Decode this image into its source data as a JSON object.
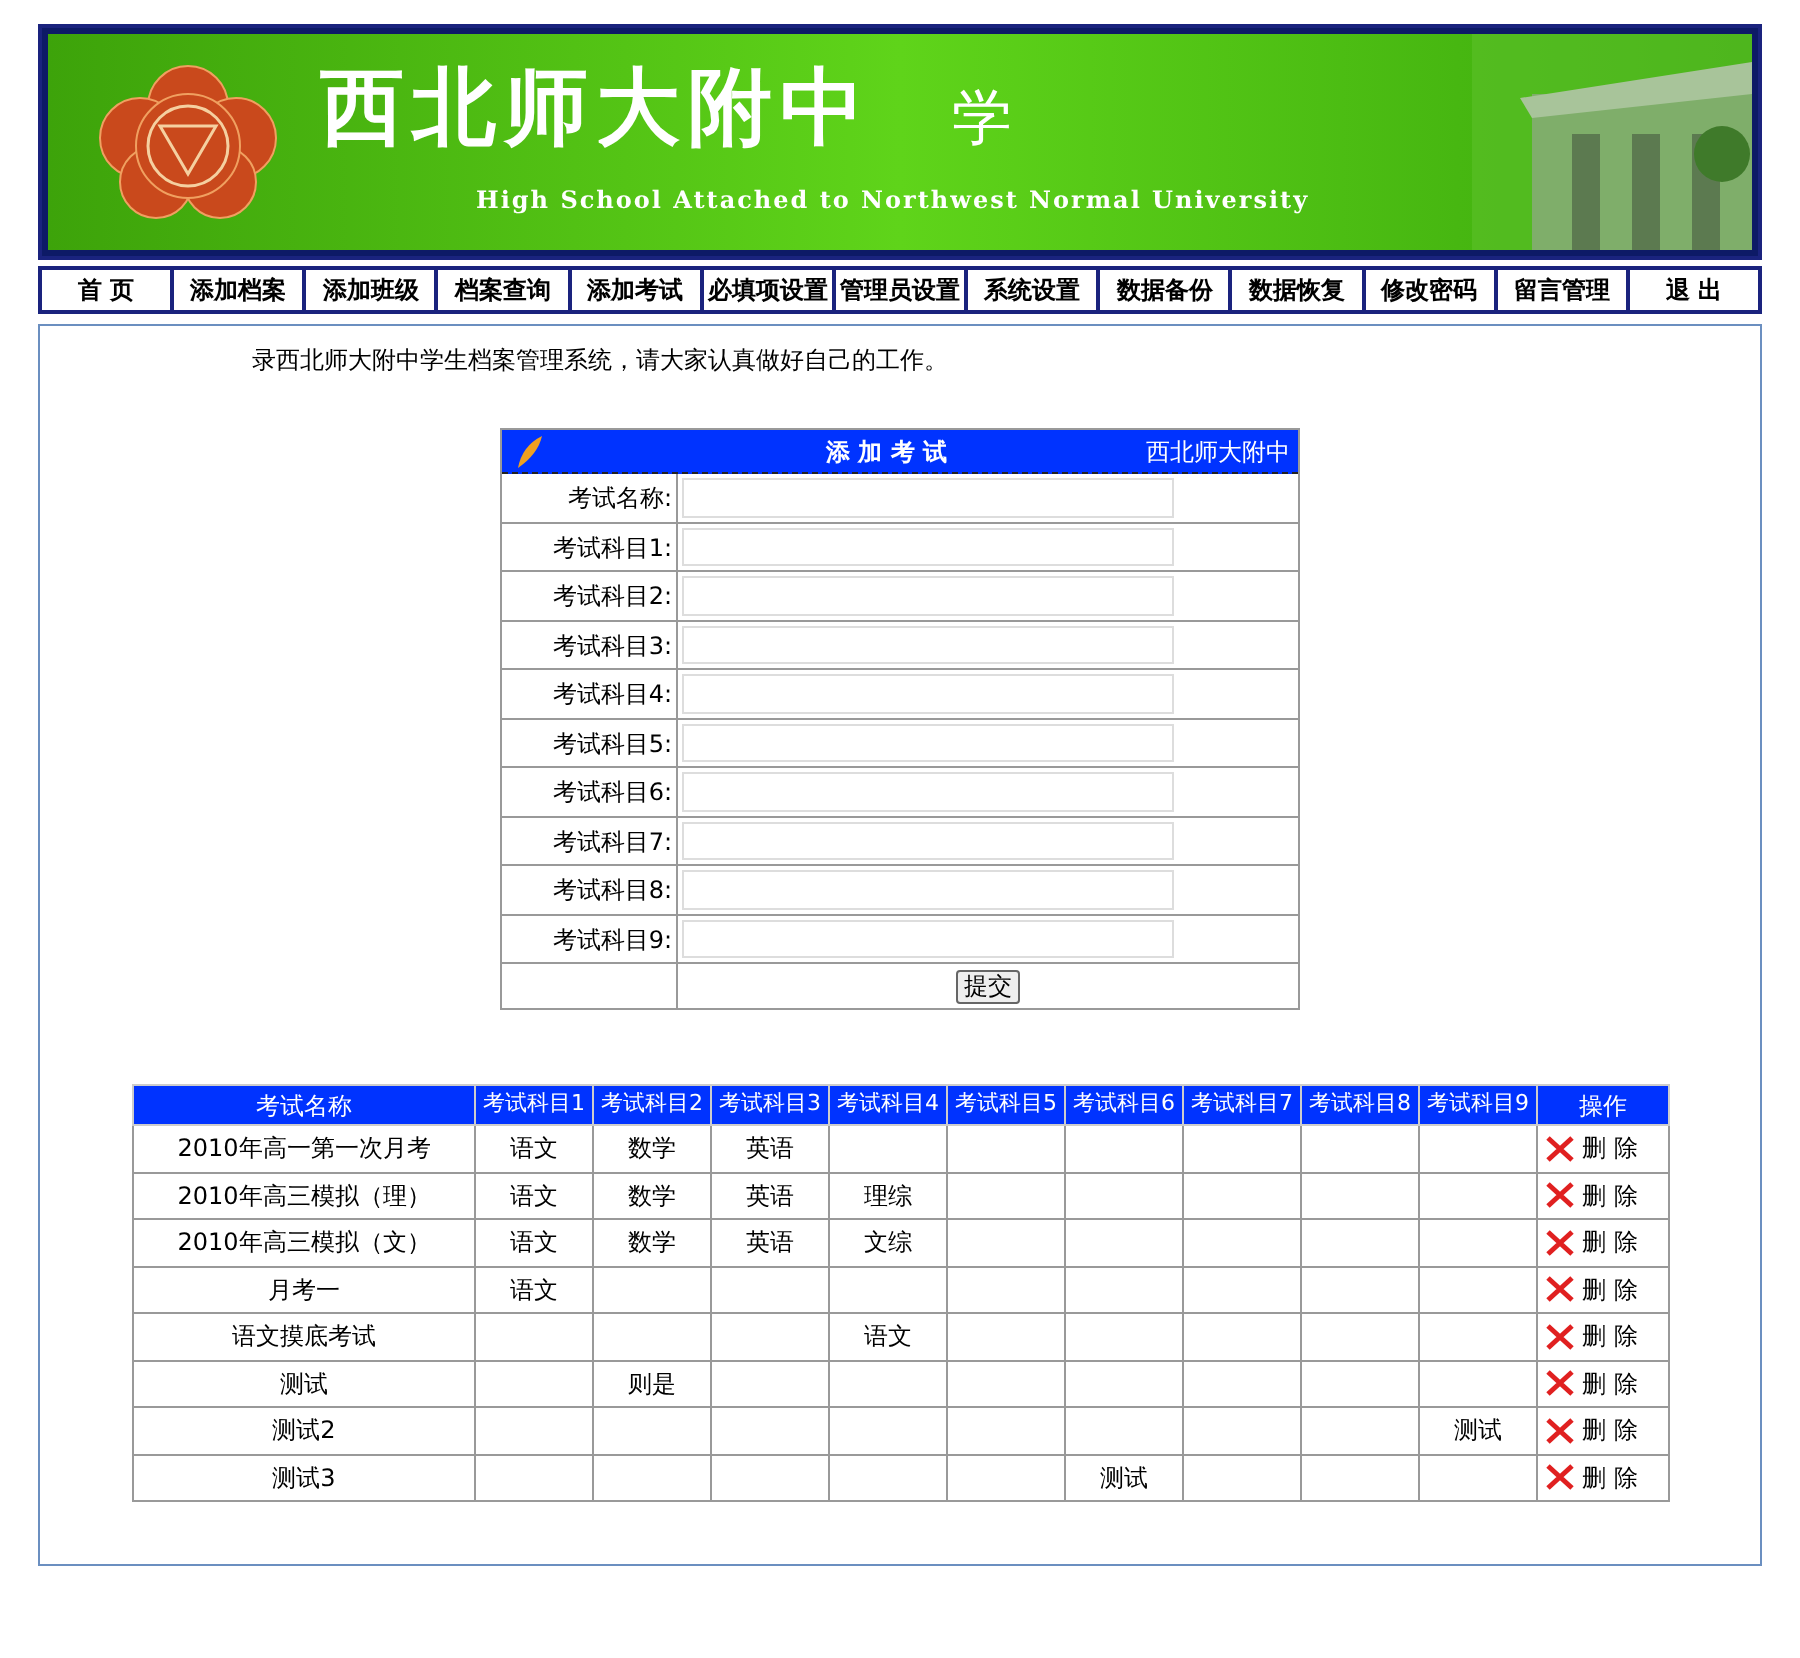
{
  "banner": {
    "title": "西北师大附中",
    "title_extra": "学",
    "subtitle": "High School Attached to Northwest Normal University"
  },
  "nav": [
    {
      "label": "首 页"
    },
    {
      "label": "添加档案"
    },
    {
      "label": "添加班级"
    },
    {
      "label": "档案查询"
    },
    {
      "label": "添加考试"
    },
    {
      "label": "必填项设置"
    },
    {
      "label": "管理员设置"
    },
    {
      "label": "系统设置"
    },
    {
      "label": "数据备份"
    },
    {
      "label": "数据恢复"
    },
    {
      "label": "修改密码"
    },
    {
      "label": "留言管理"
    },
    {
      "label": "退 出"
    }
  ],
  "welcome": "录西北师大附中学生档案管理系统，请大家认真做好自己的工作。",
  "form": {
    "title": "添 加 考 试",
    "brand": "西北师大附中",
    "fields": [
      {
        "label": "考试名称:"
      },
      {
        "label": "考试科目1:"
      },
      {
        "label": "考试科目2:"
      },
      {
        "label": "考试科目3:"
      },
      {
        "label": "考试科目4:"
      },
      {
        "label": "考试科目5:"
      },
      {
        "label": "考试科目6:"
      },
      {
        "label": "考试科目7:"
      },
      {
        "label": "考试科目8:"
      },
      {
        "label": "考试科目9:"
      }
    ],
    "submit": "提交"
  },
  "table": {
    "columns": [
      "考试名称",
      "考试科目1",
      "考试科目2",
      "考试科目3",
      "考试科目4",
      "考试科目5",
      "考试科目6",
      "考试科目7",
      "考试科目8",
      "考试科目9",
      "操作"
    ],
    "rows": [
      {
        "name": "2010年高一第一次月考",
        "subject_1": "语文",
        "subject_2": "数学",
        "subject_3": "英语",
        "action": "删 除"
      },
      {
        "name": "2010年高三模拟（理）",
        "subject_1": "语文",
        "subject_2": "数学",
        "subject_3": "英语",
        "subject_4": "理综",
        "action": "删 除"
      },
      {
        "name": "2010年高三模拟（文）",
        "subject_1": "语文",
        "subject_2": "数学",
        "subject_3": "英语",
        "subject_4": "文综",
        "action": "删 除"
      },
      {
        "name": "月考一",
        "subject_1": "语文",
        "action": "删 除"
      },
      {
        "name": "语文摸底考试",
        "subject_4": "语文",
        "action": "删 除"
      },
      {
        "name": "测试",
        "subject_2": "则是",
        "action": "删 除"
      },
      {
        "name": "测试2",
        "subject_9": "测试",
        "action": "删 除"
      },
      {
        "name": "测试3",
        "subject_6": "测试",
        "action": "删 除"
      }
    ]
  }
}
